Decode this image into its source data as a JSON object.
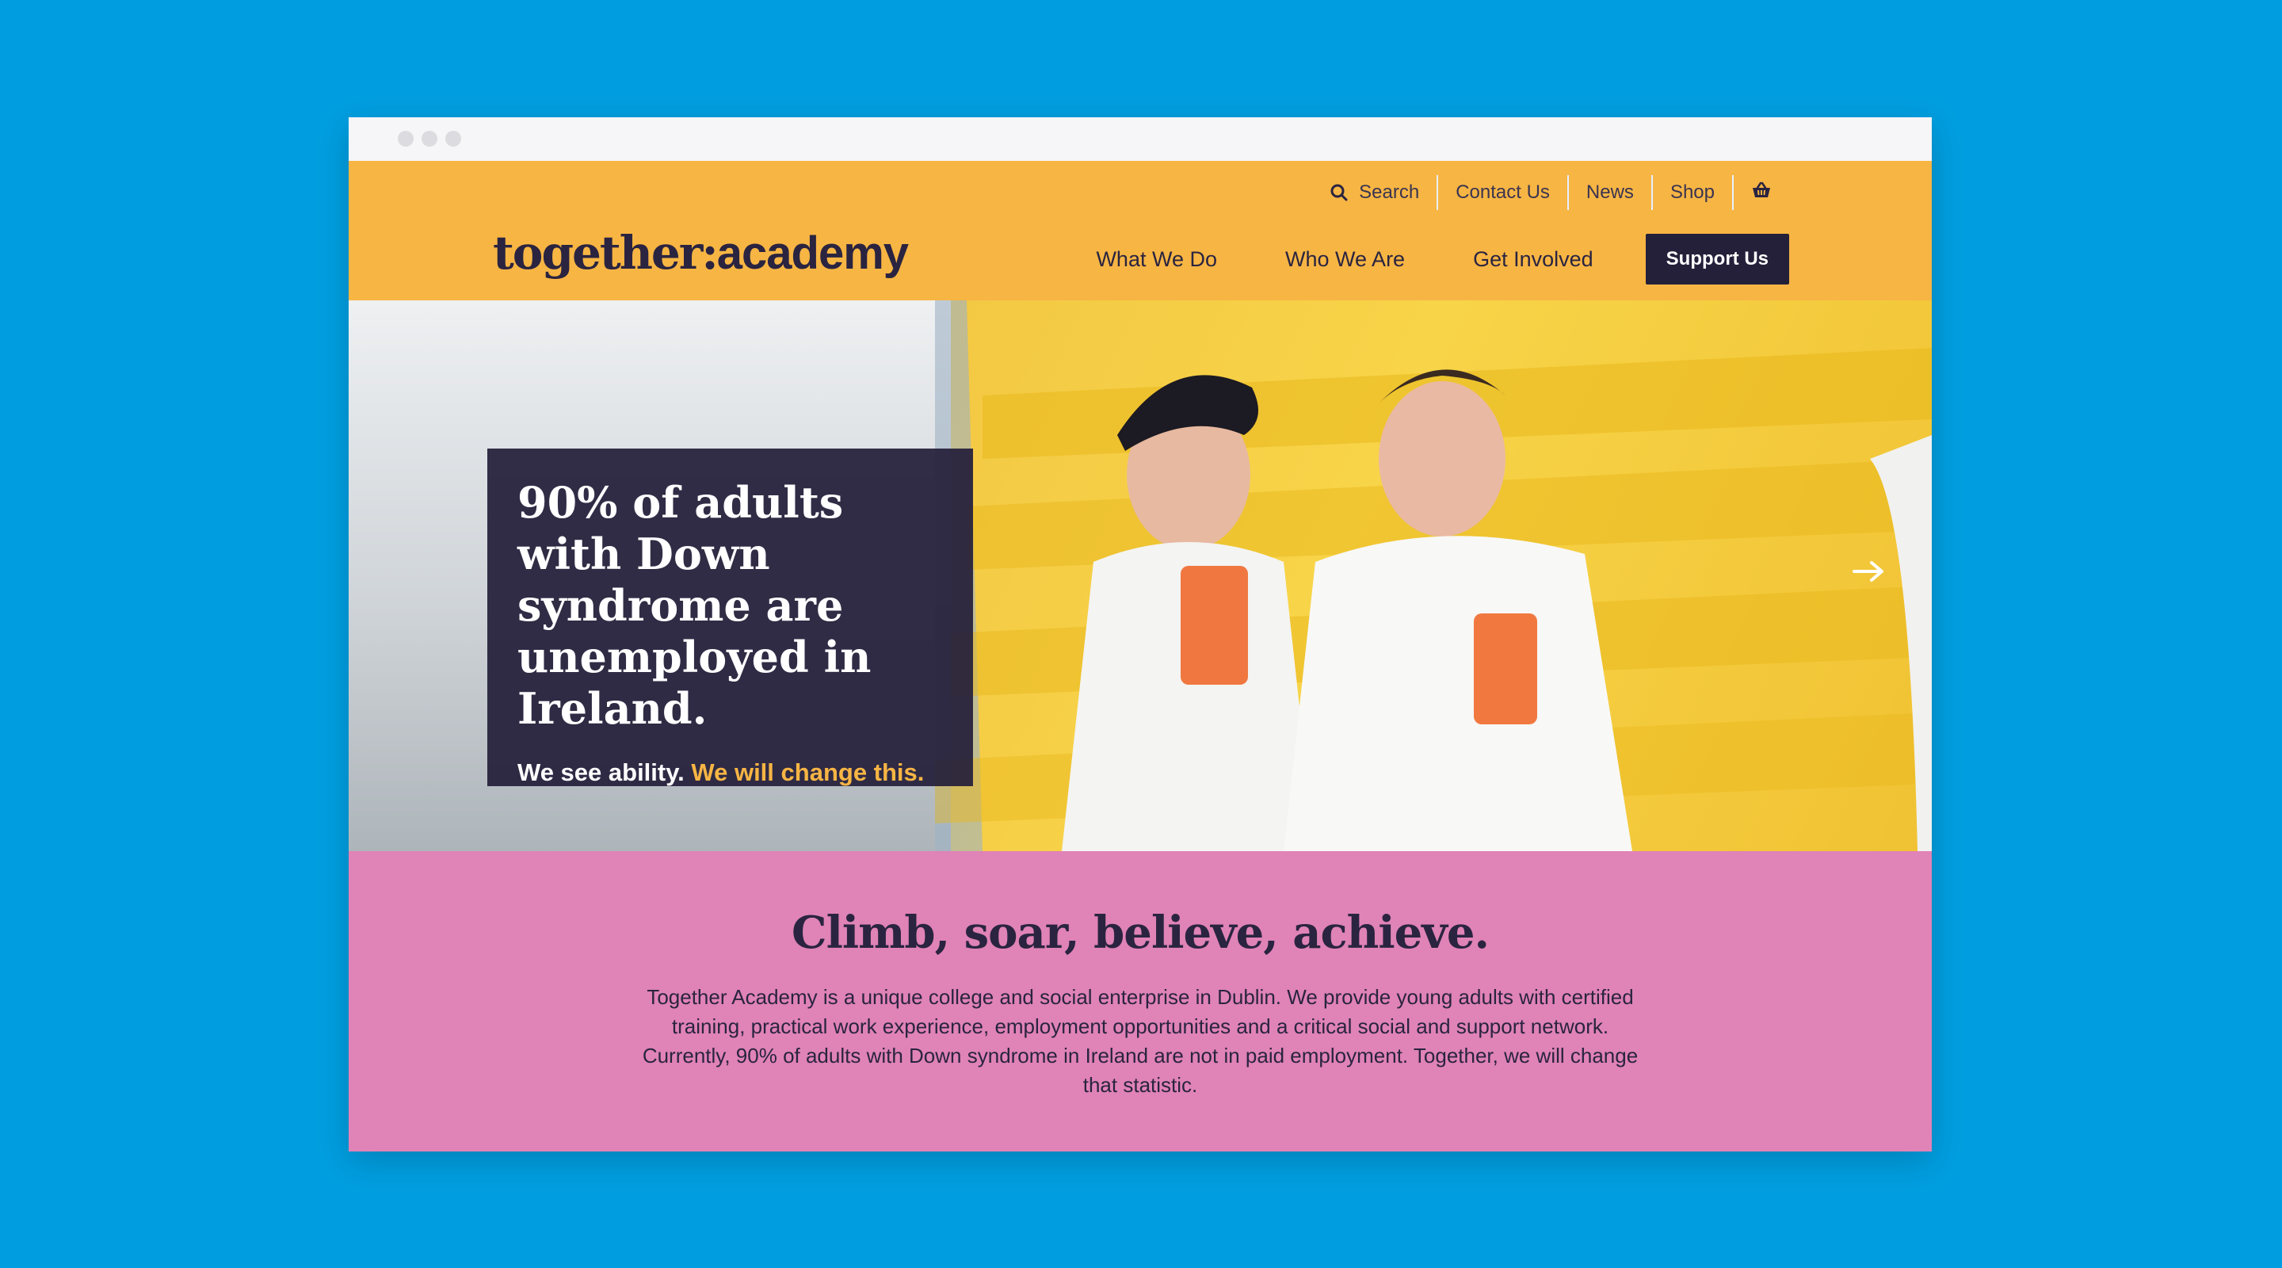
{
  "header": {
    "utility": {
      "search_label": "Search",
      "contact_label": "Contact Us",
      "news_label": "News",
      "shop_label": "Shop",
      "basket_icon": "basket-icon",
      "search_icon": "search-icon"
    },
    "logo": {
      "word1": "together",
      "sep": ":",
      "word2": "academy"
    },
    "nav": {
      "what_we_do": "What We Do",
      "who_we_are": "Who We Are",
      "get_involved": "Get Involved",
      "support_us": "Support Us"
    }
  },
  "hero": {
    "title": "90% of adults with Down syndrome are unemployed in Ireland.",
    "sub_plain": "We see ability.",
    "sub_highlight": "We will change this.",
    "next_icon": "arrow-right-icon"
  },
  "intro": {
    "title": "Climb, soar, believe, achieve.",
    "body": "Together Academy is a unique college and social enterprise in Dublin. We provide young adults with certified training, practical work experience, employment opportunities and a critical social and support network. Currently, 90% of adults with Down syndrome in Ireland are not in paid employment. Together, we will change that statistic."
  },
  "colors": {
    "page_bg": "#009ee0",
    "header_bg": "#f7b544",
    "dark": "#24203a",
    "intro_bg": "#e083b7",
    "accent": "#f7b544"
  }
}
